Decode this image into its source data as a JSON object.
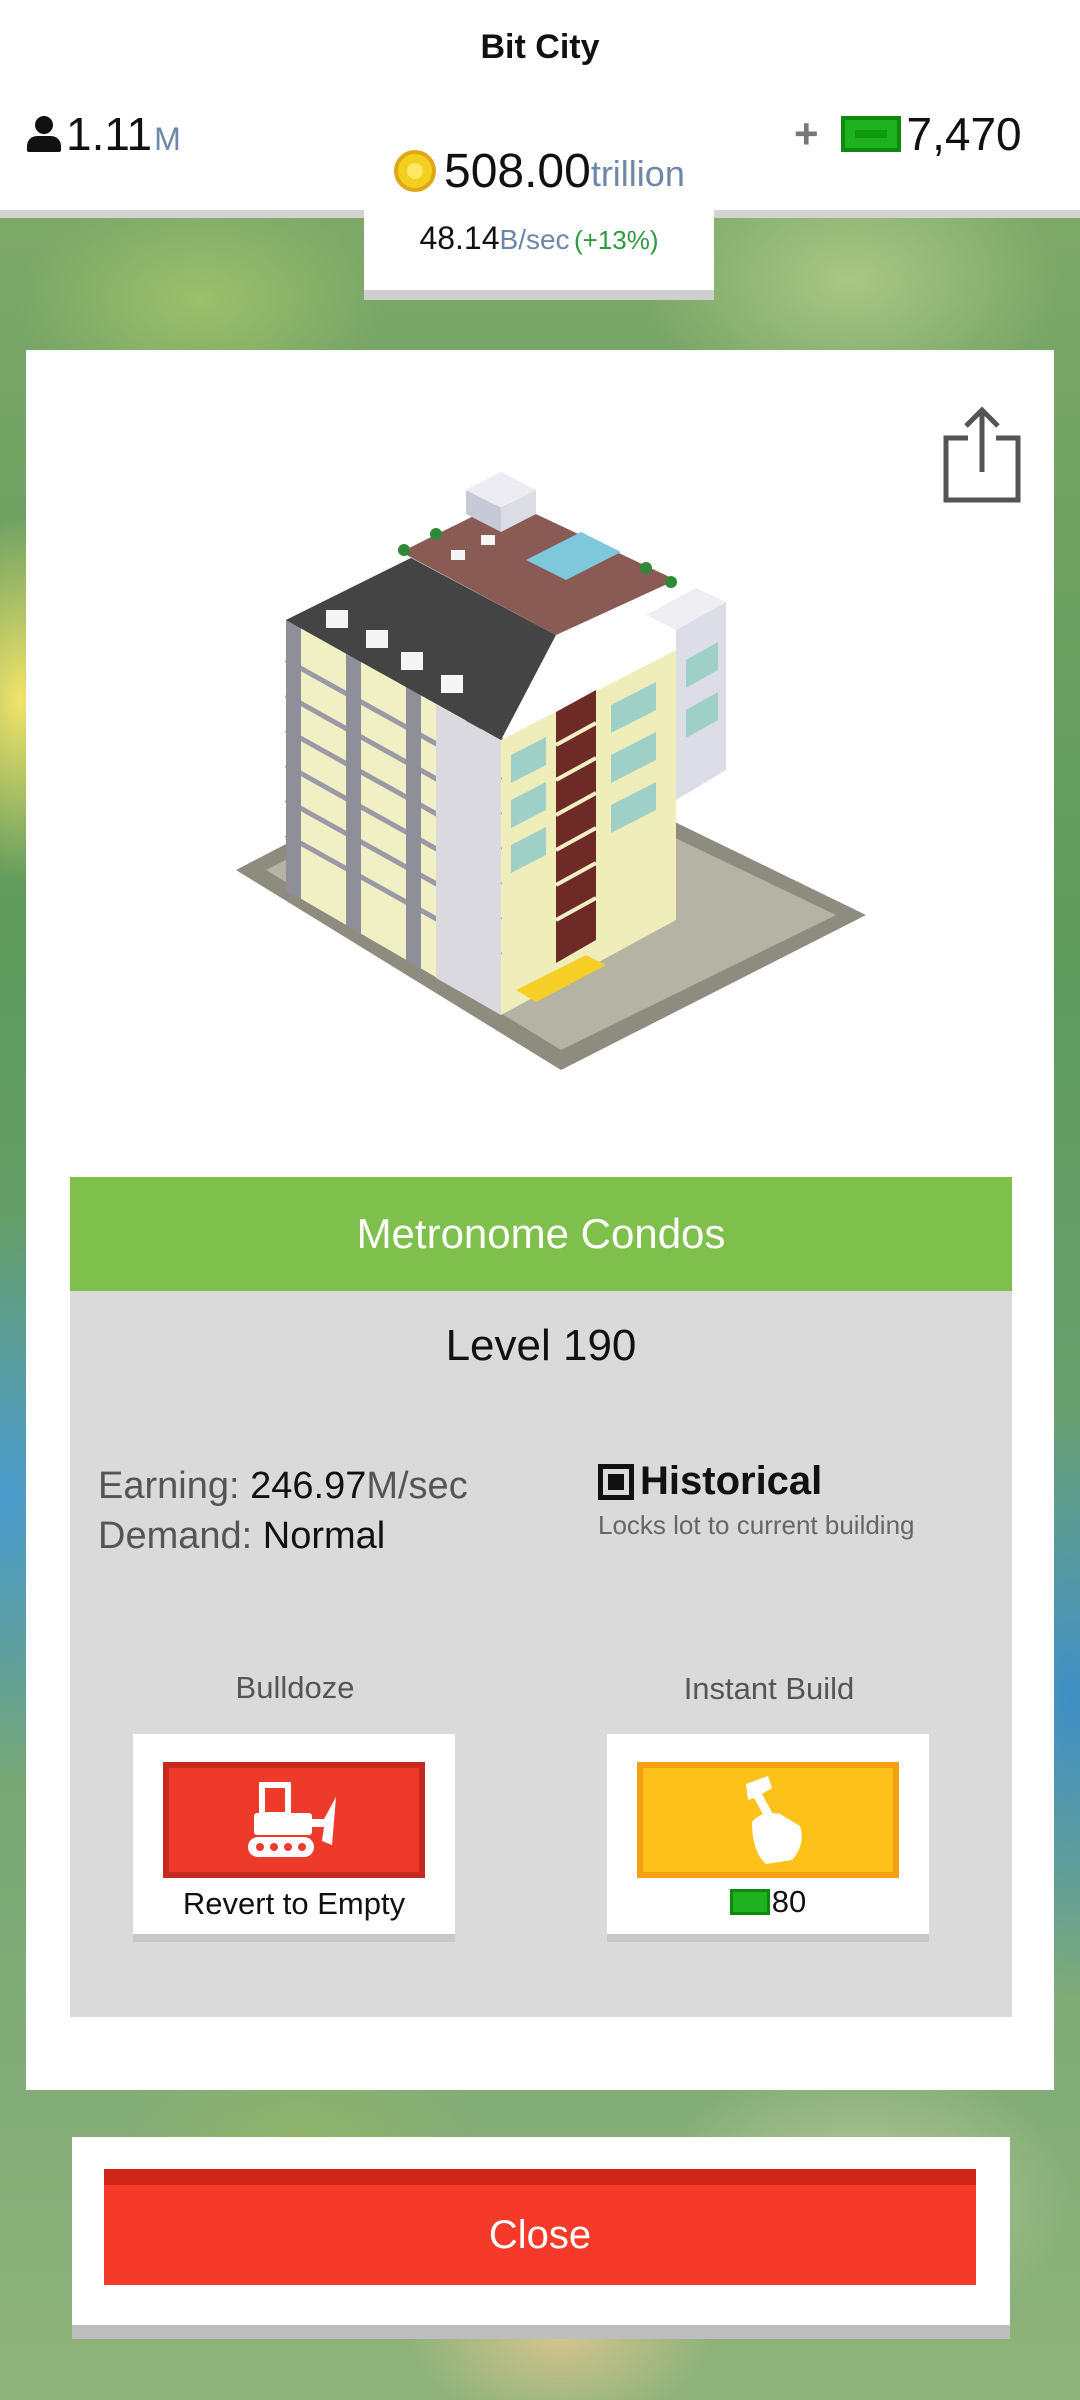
{
  "header": {
    "city_name": "Bit City",
    "population_value": "1.11",
    "population_unit": "M",
    "coins_value": "508.00",
    "coins_unit": "trillion",
    "rate_value": "48.14",
    "rate_unit": "B/sec",
    "rate_bonus": "(+13%)",
    "cash_value": "7,470",
    "icons": {
      "population": "person-icon",
      "coins": "coin-icon",
      "cash": "cash-icon",
      "add": "plus-icon"
    }
  },
  "card": {
    "share_icon": "share-icon",
    "building_name": "Metronome Condos",
    "level_text": "Level 190",
    "earning_label": "Earning:",
    "earning_value": "246.97",
    "earning_unit": "M/sec",
    "demand_label": "Demand:",
    "demand_value": "Normal",
    "historical_title": "Historical",
    "historical_desc": "Locks lot to current building",
    "bulldoze_label": "Bulldoze",
    "bulldoze_caption": "Revert to Empty",
    "instant_label": "Instant Build",
    "instant_cost": "80"
  },
  "footer": {
    "close_label": "Close"
  },
  "colors": {
    "title_green": "#7fc04d",
    "bulldoze_red": "#ee3a2b",
    "instant_yellow": "#fcc21a",
    "close_red": "#f63a2a",
    "cash_green": "#1eb21e",
    "unit_blue": "#6d87a8"
  }
}
